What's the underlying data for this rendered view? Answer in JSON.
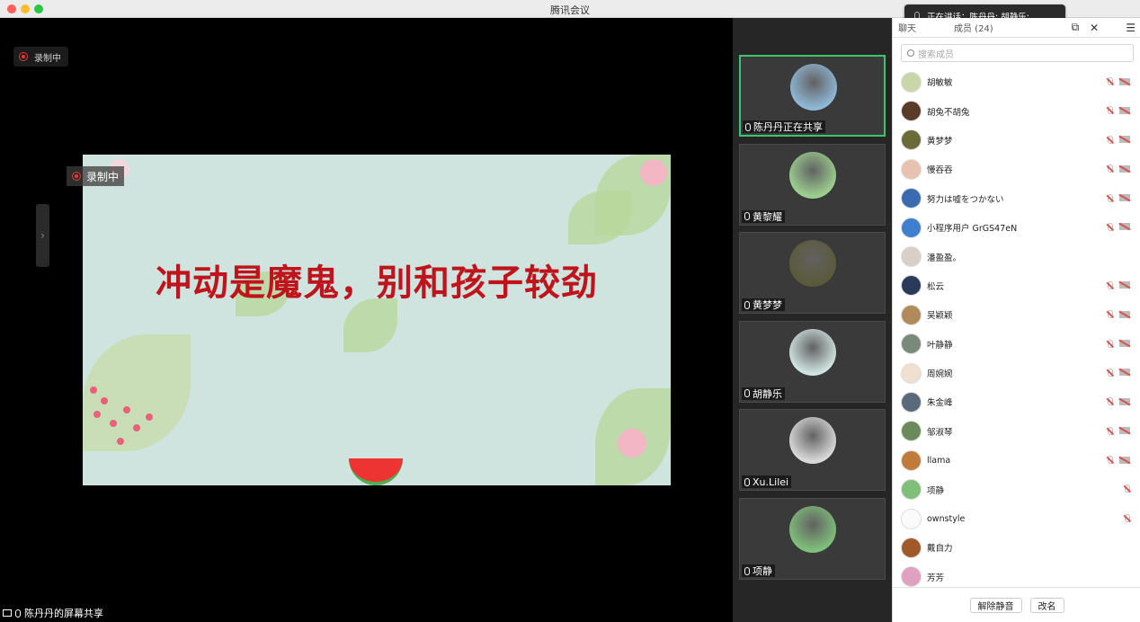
{
  "window": {
    "title": "腾讯会议"
  },
  "recording": {
    "top_label": "录制中",
    "slide_label": "录制中"
  },
  "slide": {
    "title": "冲动是魔鬼，别和孩子较劲"
  },
  "share_label": "陈丹丹的屏幕共享",
  "speaking_toast": {
    "text": "正在讲话：陈丹丹; 胡静乐;"
  },
  "video_tiles": [
    {
      "name": "陈丹丹正在共享",
      "active": true,
      "color": "#8fb7d6"
    },
    {
      "name": "黄黎耀",
      "active": false,
      "color": "#9ccf8f"
    },
    {
      "name": "黄梦梦",
      "active": false,
      "color": "#5a5a3a"
    },
    {
      "name": "胡静乐",
      "active": false,
      "color": "#cfe3e0"
    },
    {
      "name": "Xu.Lilei",
      "active": false,
      "color": "#d9d9d9"
    },
    {
      "name": "项静",
      "active": false,
      "color": "#7fbf7a"
    }
  ],
  "panel": {
    "tabs": {
      "chat": "聊天",
      "members": "成员 (24)"
    },
    "search_placeholder": "搜索成员",
    "members": [
      {
        "name": "胡敏敏",
        "color": "#c9d7a8",
        "muted": true,
        "cam_off": true
      },
      {
        "name": "胡兔不胡兔",
        "color": "#5a3a2a",
        "muted": true,
        "cam_off": true
      },
      {
        "name": "黄梦梦",
        "color": "#6b6b3a",
        "muted": true,
        "cam_off": true
      },
      {
        "name": "慢吞吞",
        "color": "#e8c2b0",
        "muted": true,
        "cam_off": true
      },
      {
        "name": "努力は嘘をつかない",
        "color": "#3a6bb0",
        "muted": true,
        "cam_off": true
      },
      {
        "name": "小程序用户 GrGS47eN",
        "color": "#3f7fd0",
        "muted": true,
        "cam_off": true
      },
      {
        "name": "潘盈盈。",
        "color": "#d8d0c8",
        "muted": false,
        "cam_off": false
      },
      {
        "name": "松云",
        "color": "#2a3a5a",
        "muted": true,
        "cam_off": true
      },
      {
        "name": "吴颖颖",
        "color": "#b08a5a",
        "muted": true,
        "cam_off": true
      },
      {
        "name": "叶静静",
        "color": "#7a8a7a",
        "muted": true,
        "cam_off": true
      },
      {
        "name": "周婉婉",
        "color": "#f0e0d0",
        "muted": true,
        "cam_off": true
      },
      {
        "name": "朱金峰",
        "color": "#5a6a7a",
        "muted": true,
        "cam_off": true
      },
      {
        "name": "邹淑琴",
        "color": "#6a8a5a",
        "muted": true,
        "cam_off": true
      },
      {
        "name": "llama",
        "color": "#c07a3a",
        "muted": true,
        "cam_off": true
      },
      {
        "name": "项静",
        "color": "#7fbf7a",
        "muted": true,
        "cam_off": false
      },
      {
        "name": "ownstyle",
        "color": "#fafafa",
        "muted": true,
        "cam_off": false
      },
      {
        "name": "戴自力",
        "color": "#a05a2a",
        "muted": false,
        "cam_off": false
      },
      {
        "name": "芳芳",
        "color": "#e0a0c0",
        "muted": false,
        "cam_off": false
      }
    ],
    "buttons": {
      "unmute": "解除静音",
      "rename": "改名"
    }
  }
}
